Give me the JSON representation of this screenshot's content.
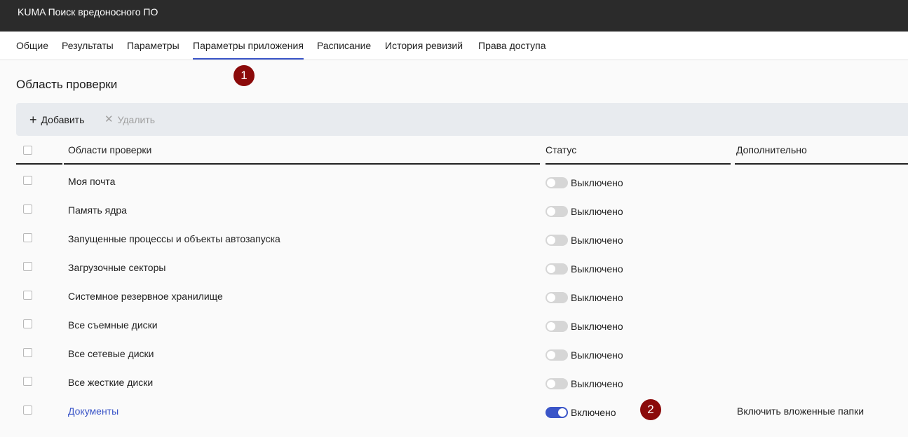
{
  "window": {
    "title": "KUMA Поиск вредоносного ПО"
  },
  "tabs": [
    {
      "label": "Общие",
      "active": false
    },
    {
      "label": "Результаты",
      "active": false
    },
    {
      "label": "Параметры",
      "active": false
    },
    {
      "label": "Параметры приложения",
      "active": true
    },
    {
      "label": "Расписание",
      "active": false
    },
    {
      "label": "История ревизий",
      "active": false
    },
    {
      "label": "Права доступа",
      "active": false
    }
  ],
  "section": {
    "title": "Область проверки"
  },
  "toolbar": {
    "add_label": "Добавить",
    "add_icon": "plus-icon",
    "delete_label": "Удалить",
    "delete_icon": "close-icon",
    "delete_enabled": false
  },
  "table": {
    "columns": [
      "Области проверки",
      "Статус",
      "Дополнительно"
    ],
    "rows": [
      {
        "name": "Моя почта",
        "status": "Выключено",
        "enabled": false,
        "extra": ""
      },
      {
        "name": "Память ядра",
        "status": "Выключено",
        "enabled": false,
        "extra": ""
      },
      {
        "name": "Запущенные процессы и объекты автозапуска",
        "status": "Выключено",
        "enabled": false,
        "extra": ""
      },
      {
        "name": "Загрузочные секторы",
        "status": "Выключено",
        "enabled": false,
        "extra": ""
      },
      {
        "name": "Системное резервное хранилище",
        "status": "Выключено",
        "enabled": false,
        "extra": ""
      },
      {
        "name": "Все съемные диски",
        "status": "Выключено",
        "enabled": false,
        "extra": ""
      },
      {
        "name": "Все сетевые диски",
        "status": "Выключено",
        "enabled": false,
        "extra": ""
      },
      {
        "name": "Все жесткие диски",
        "status": "Выключено",
        "enabled": false,
        "extra": ""
      },
      {
        "name": "Документы",
        "status": "Включено",
        "enabled": true,
        "extra": "Включить вложенные папки",
        "is_link": true
      }
    ]
  },
  "markers": [
    "1",
    "2"
  ],
  "colors": {
    "accent": "#3a55c8",
    "titlebar": "#2b2b2b",
    "marker": "#8b0a0a",
    "toolbar_bg": "#e8ebef"
  }
}
